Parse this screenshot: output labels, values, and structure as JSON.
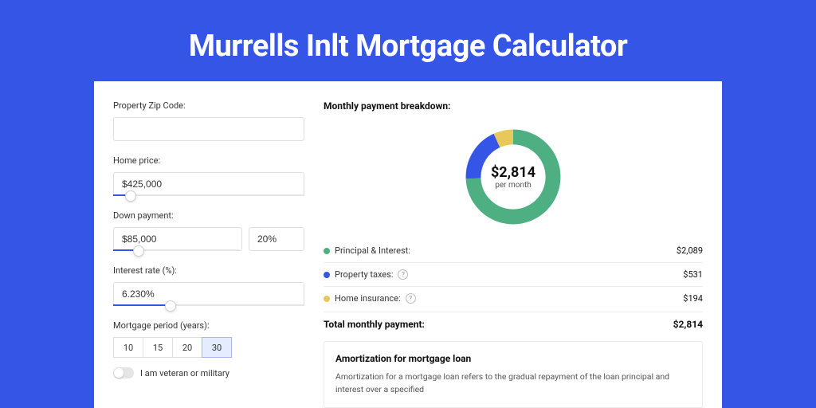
{
  "page": {
    "title": "Murrells Inlt Mortgage Calculator"
  },
  "form": {
    "zip_label": "Property Zip Code:",
    "zip_value": "",
    "home_price_label": "Home price:",
    "home_price_value": "$425,000",
    "home_price_slider_pct": 9,
    "down_payment_label": "Down payment:",
    "down_payment_amount": "$85,000",
    "down_payment_pct": "20%",
    "down_payment_slider_pct": 20,
    "interest_label": "Interest rate (%):",
    "interest_value": "6.230%",
    "interest_slider_pct": 30,
    "period_label": "Mortgage period (years):",
    "period_options": [
      "10",
      "15",
      "20",
      "30"
    ],
    "period_selected": "30",
    "veteran_label": "I am veteran or military"
  },
  "breakdown": {
    "title": "Monthly payment breakdown:",
    "center_amount": "$2,814",
    "center_sub": "per month",
    "items": [
      {
        "label": "Principal & Interest:",
        "value": "$2,089",
        "color": "#4eaf82",
        "pct": 74.2
      },
      {
        "label": "Property taxes:",
        "value": "$531",
        "color": "#3555e6",
        "pct": 18.9,
        "help": true
      },
      {
        "label": "Home insurance:",
        "value": "$194",
        "color": "#e8c85a",
        "pct": 6.9,
        "help": true
      }
    ],
    "total_label": "Total monthly payment:",
    "total_value": "$2,814"
  },
  "chart_data": {
    "type": "pie",
    "title": "Monthly payment breakdown",
    "series": [
      {
        "name": "Principal & Interest",
        "value": 2089,
        "color": "#4eaf82"
      },
      {
        "name": "Property taxes",
        "value": 531,
        "color": "#3555e6"
      },
      {
        "name": "Home insurance",
        "value": 194,
        "color": "#e8c85a"
      }
    ],
    "total": 2814,
    "center_label": "per month"
  },
  "amort": {
    "title": "Amortization for mortgage loan",
    "text": "Amortization for a mortgage loan refers to the gradual repayment of the loan principal and interest over a specified"
  }
}
